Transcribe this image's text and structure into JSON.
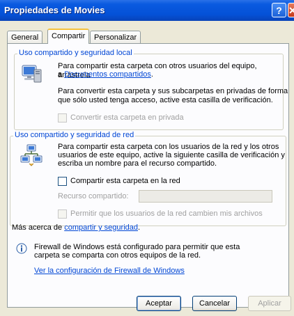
{
  "window": {
    "title": "Propiedades de Movies"
  },
  "tabs": [
    {
      "label": "General"
    },
    {
      "label": "Compartir"
    },
    {
      "label": "Personalizar"
    }
  ],
  "local_group": {
    "legend": "Uso compartido y seguridad local",
    "para1_line1": "Para compartir esta carpeta con otros usuarios del equipo, arrástrela",
    "para1_prefix": "a",
    "para1_link": "Documentos compartidos",
    "para1_suffix": ".",
    "para2_line1": "Para convertir esta carpeta y sus subcarpetas en privadas de forma",
    "para2_line2": "que sólo usted tenga acceso, active esta casilla de verificación.",
    "private_checkbox_label": "Convertir esta carpeta en privada"
  },
  "network_group": {
    "legend": "Uso compartido y seguridad de red",
    "para_line1": "Para compartir esta carpeta con los usuarios de la red y los otros",
    "para_line2": "usuarios de este equipo, active la siguiente casilla de verificación y",
    "para_line3": "escriba un nombre para el recurso compartido.",
    "share_checkbox_label": "Compartir esta carpeta en la red",
    "share_name_label": "Recurso compartido:",
    "share_name_value": "",
    "allow_change_label": "Permitir que los usuarios de la red cambien mis archivos"
  },
  "more_info": {
    "prefix": "Más acerca de",
    "link": "compartir y seguridad",
    "suffix": "."
  },
  "firewall": {
    "line1": "Firewall de Windows está configurado para permitir que esta",
    "line2": "carpeta se comparta con otros equipos de la red.",
    "link": "Ver la configuración de Firewall de Windows"
  },
  "buttons": {
    "ok": "Aceptar",
    "cancel": "Cancelar",
    "apply": "Aplicar"
  }
}
